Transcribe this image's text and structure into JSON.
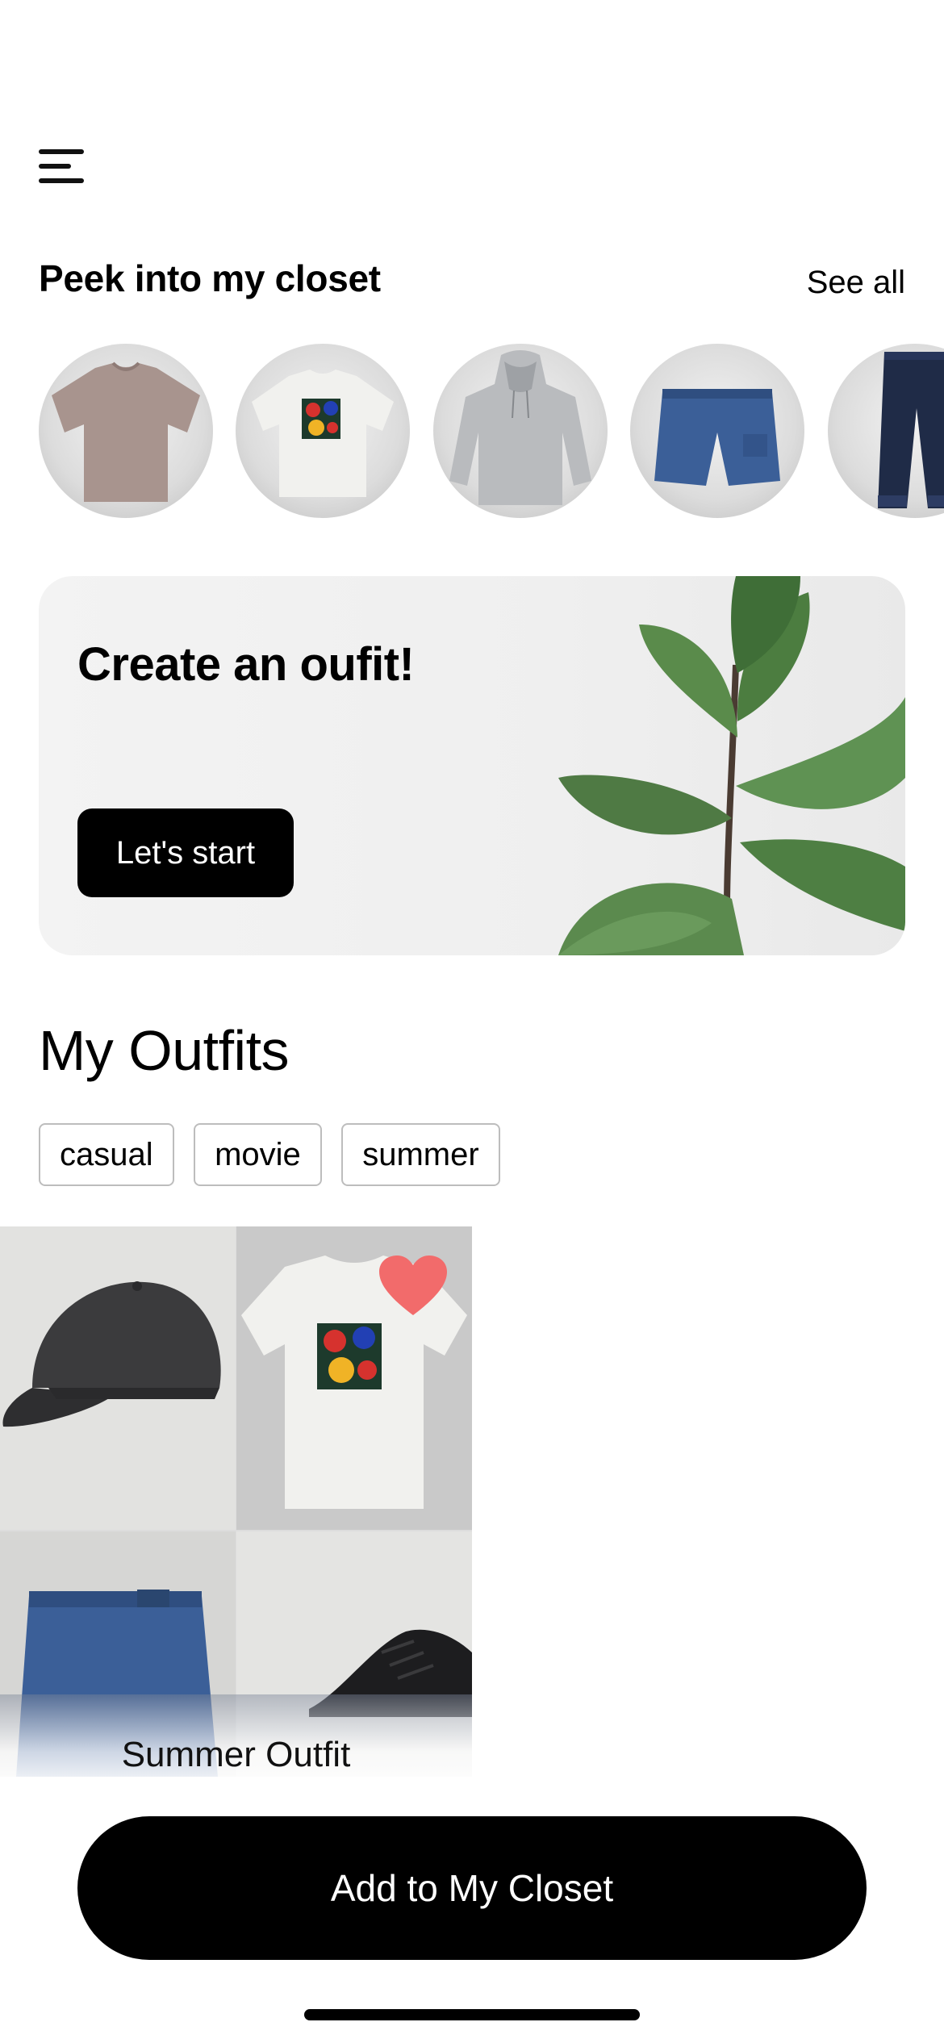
{
  "header": {
    "menu_icon": "hamburger-menu-icon"
  },
  "closet": {
    "title": "Peek into my closet",
    "see_all_label": "See all",
    "items": [
      {
        "name": "mauve t-shirt",
        "color": "#a8948e"
      },
      {
        "name": "white graphic t-shirt",
        "color": "#eeeeea"
      },
      {
        "name": "grey hoodie",
        "color": "#b9bbbe"
      },
      {
        "name": "blue shorts",
        "color": "#3b5f98"
      },
      {
        "name": "dark jeans",
        "color": "#1f2b47"
      }
    ]
  },
  "hero": {
    "title": "Create an oufit!",
    "button_label": "Let's start"
  },
  "outfits": {
    "title": "My Outfits",
    "tags": [
      "casual",
      "movie",
      "summer"
    ],
    "cards": [
      {
        "label": "Summer Outfit",
        "favorite": true
      }
    ]
  },
  "footer": {
    "add_button_label": "Add to My Closet"
  },
  "colors": {
    "accent": "#000000",
    "heart": "#f26b6b",
    "tag_border": "#bdbdbd"
  }
}
